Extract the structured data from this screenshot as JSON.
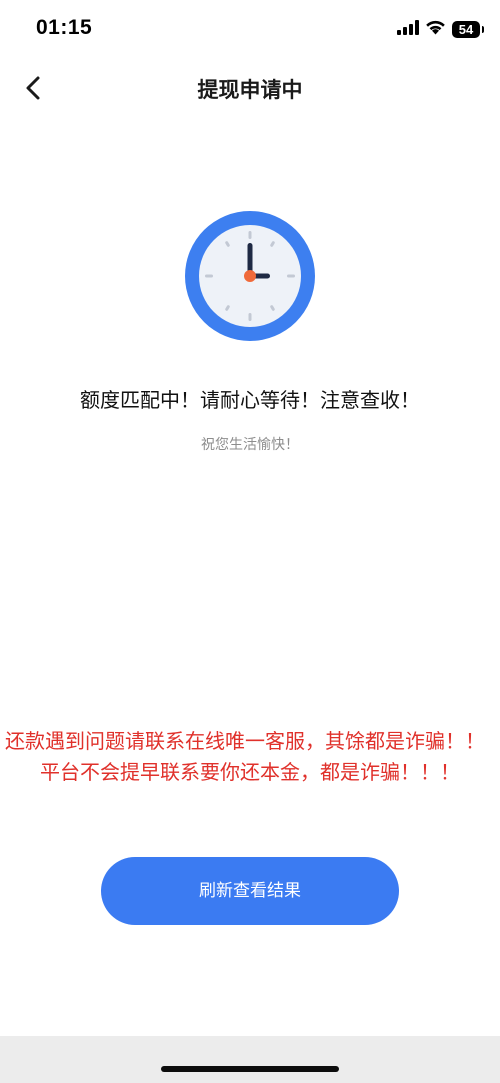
{
  "status_bar": {
    "time": "01:15",
    "battery_level": "54",
    "icons": [
      "cellular-signal-icon",
      "wifi-icon",
      "battery-icon"
    ]
  },
  "nav": {
    "back_icon": "chevron-left-icon",
    "title": "提现申请中"
  },
  "content": {
    "clock_icon": "clock-icon",
    "main_message": "额度匹配中！请耐心等待！注意查收！",
    "sub_message": "祝您生活愉快！"
  },
  "warnings": {
    "line1": "还款遇到问题请联系在线唯一客服，其馀都是诈骗！！",
    "line2": "平台不会提早联系要你还本金，都是诈骗！！！"
  },
  "actions": {
    "refresh_label": "刷新查看结果"
  },
  "colors": {
    "accent": "#3b7bf2",
    "warning": "#e0312b",
    "clock_ring": "#3d7ff0",
    "clock_face": "#eef2f8",
    "clock_hand": "#1f2a44",
    "clock_center": "#f06a3a"
  }
}
